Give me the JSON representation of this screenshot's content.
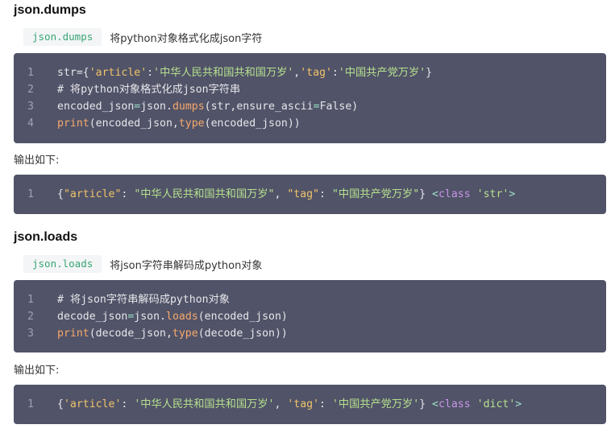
{
  "section1": {
    "heading": "json.dumps",
    "tag": "json.dumps",
    "desc": "将python对象格式化成json字符",
    "code_lines": [
      {
        "num": "1"
      },
      {
        "num": "2",
        "comment": "# 将python对象格式化成json字符串"
      },
      {
        "num": "3"
      },
      {
        "num": "4"
      }
    ],
    "output_label": "输出如下:",
    "output_num": "1"
  },
  "section2": {
    "heading": "json.loads",
    "tag": "json.loads",
    "desc": "将json字符串解码成python对象",
    "code_lines": [
      {
        "num": "1",
        "comment": "# 将json字符串解码成python对象"
      },
      {
        "num": "2"
      },
      {
        "num": "3"
      }
    ],
    "output_label": "输出如下:",
    "output_num": "1"
  },
  "tokens": {
    "str_assign": "str={",
    "article_key": "'article'",
    "colon": ":",
    "article_val": "'中华人民共和国共和国万岁'",
    "comma": ",",
    "tag_key": "'tag'",
    "tag_val": "'中国共产党万岁'",
    "close_brace": "}",
    "encoded_json": "encoded_json",
    "eq": "=",
    "json_dot": "json.",
    "dumps": "dumps",
    "dumps_args": "(str,ensure_ascii",
    "false_close": "False)",
    "print": "print",
    "print_args1": "(encoded_json,",
    "type": "type",
    "type_args1": "(encoded_json))",
    "decode_json": "decode_json",
    "loads": "loads",
    "loads_args": "(encoded_json)",
    "print_args2": "(decode_json,",
    "type_args2": "(decode_json))",
    "out1_open": "{",
    "out1_article": "\"article\"",
    "out1_colon": ": ",
    "out1_article_val": "\"中华人民共和国共和国万岁\"",
    "out1_comma": ", ",
    "out1_tag": "\"tag\"",
    "out1_tag_val": "\"中国共产党万岁\"",
    "out1_close": "} ",
    "lt": "<",
    "class_kw": "class",
    "out1_type": "'str'",
    "gt": ">",
    "out2_article": "'article'",
    "out2_article_val": "'中华人民共和国共和国万岁'",
    "out2_tag": "'tag'",
    "out2_tag_val": "'中国共产党万岁'",
    "out2_type": "'dict'"
  },
  "colors": {
    "code_bg": "#515368",
    "tag_bg": "#f3f5f6",
    "tag_fg": "#3aa675"
  }
}
